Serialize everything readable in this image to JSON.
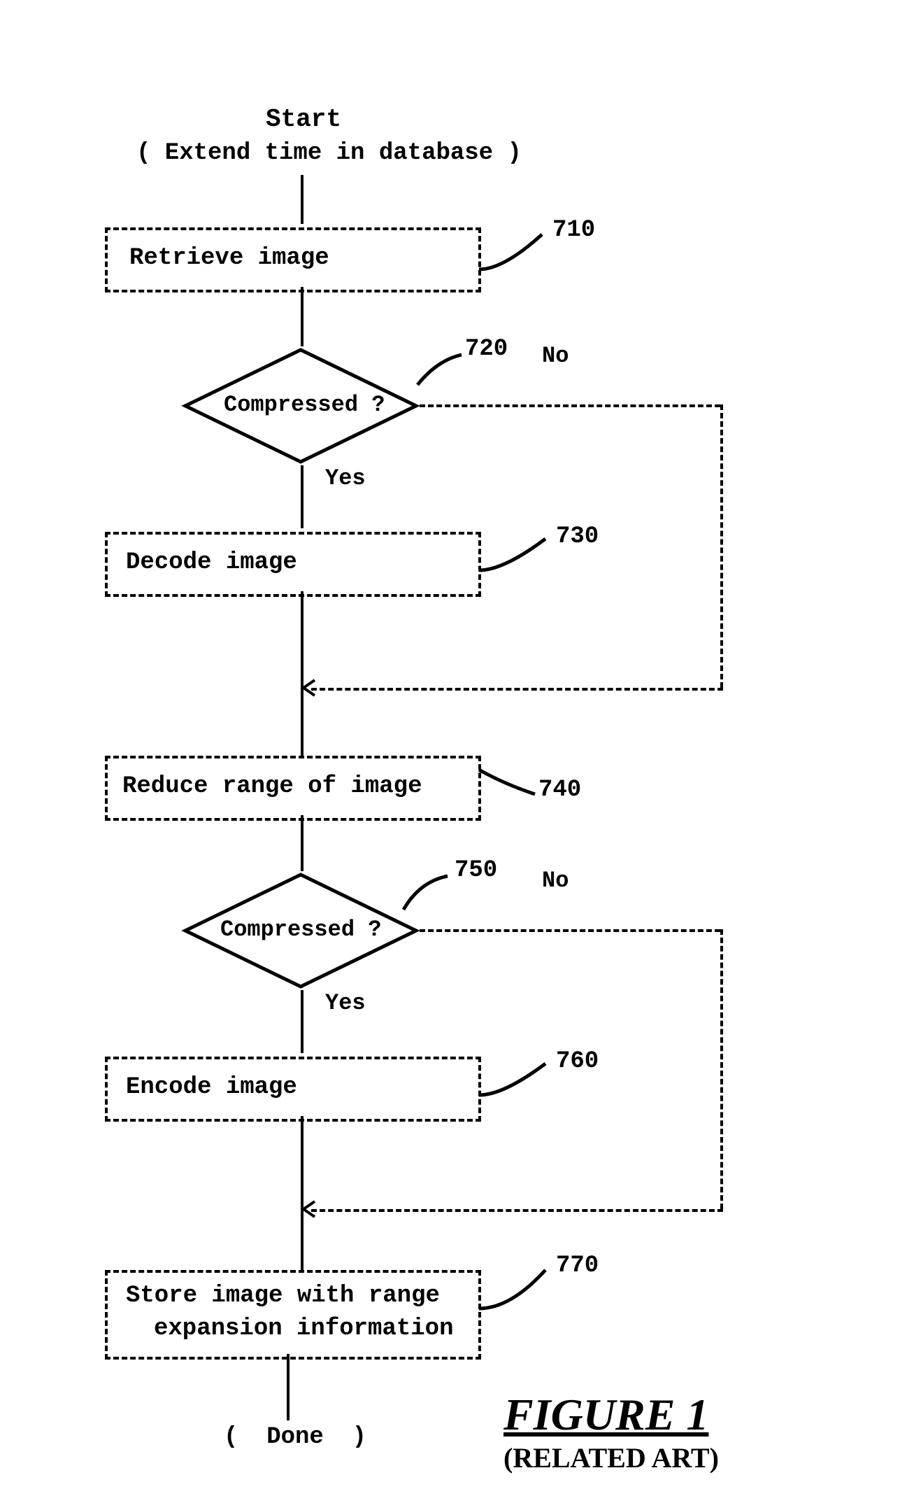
{
  "start": {
    "line1": "Start",
    "line2": "( Extend time in database )"
  },
  "steps": {
    "retrieve": "Retrieve image",
    "decode": "Decode image",
    "reduce": "Reduce range of image",
    "encode": "Encode image",
    "store1": "Store image with range",
    "store2": "expansion information"
  },
  "decisions": {
    "d1": "Compressed ?",
    "d2": "Compressed ?"
  },
  "labels": {
    "yes": "Yes",
    "no": "No"
  },
  "refs": {
    "r710": "710",
    "r720": "720",
    "r730": "730",
    "r740": "740",
    "r750": "750",
    "r760": "760",
    "r770": "770"
  },
  "done": "(  Done  )",
  "figure": {
    "main": "FIGURE 1",
    "sub": "(RELATED ART)"
  }
}
